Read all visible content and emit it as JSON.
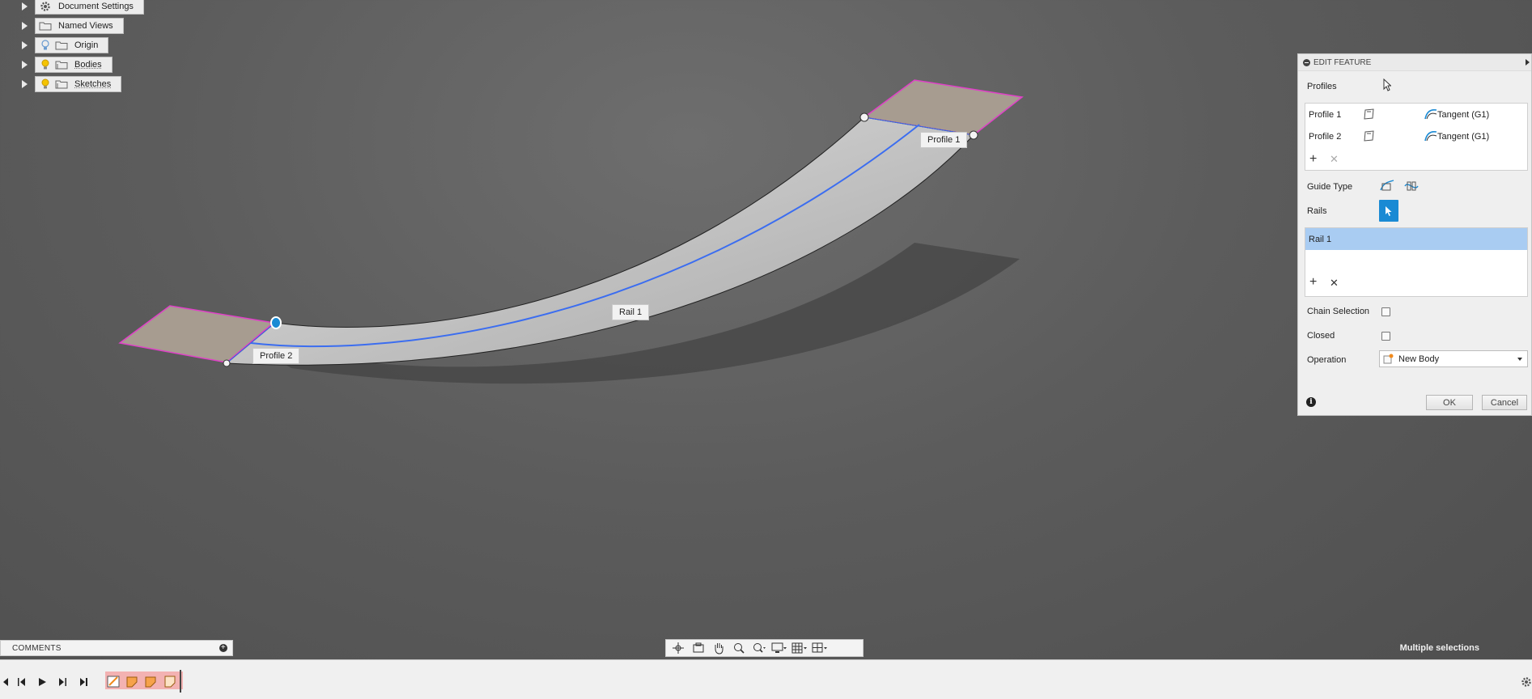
{
  "browser": {
    "items": [
      {
        "label": "Document Settings",
        "icon": "gear-icon"
      },
      {
        "label": "Named Views",
        "icon": "folder-icon"
      },
      {
        "label": "Origin",
        "icon": "folder-icon"
      },
      {
        "label": "Bodies",
        "icon": "folder-icon"
      },
      {
        "label": "Sketches",
        "icon": "folder-icon"
      }
    ]
  },
  "viewport": {
    "labels": {
      "profile1": "Profile 1",
      "profile2": "Profile 2",
      "rail1": "Rail 1"
    }
  },
  "panel": {
    "title": "EDIT FEATURE",
    "profiles_label": "Profiles",
    "profiles": [
      {
        "name": "Profile 1",
        "condition": "Tangent (G1)"
      },
      {
        "name": "Profile 2",
        "condition": "Tangent (G1)"
      }
    ],
    "guide_type_label": "Guide Type",
    "rails_label": "Rails",
    "rails": [
      "Rail 1"
    ],
    "chain_selection_label": "Chain Selection",
    "closed_label": "Closed",
    "operation_label": "Operation",
    "operation_value": "New Body",
    "ok_label": "OK",
    "cancel_label": "Cancel"
  },
  "comments": {
    "label": "COMMENTS"
  },
  "status": {
    "text": "Multiple selections"
  },
  "colors": {
    "accent": "#1a8ad4",
    "profile_edge": "#e040c8",
    "rail": "#3b6df0",
    "selection": "#a9ccf2"
  }
}
